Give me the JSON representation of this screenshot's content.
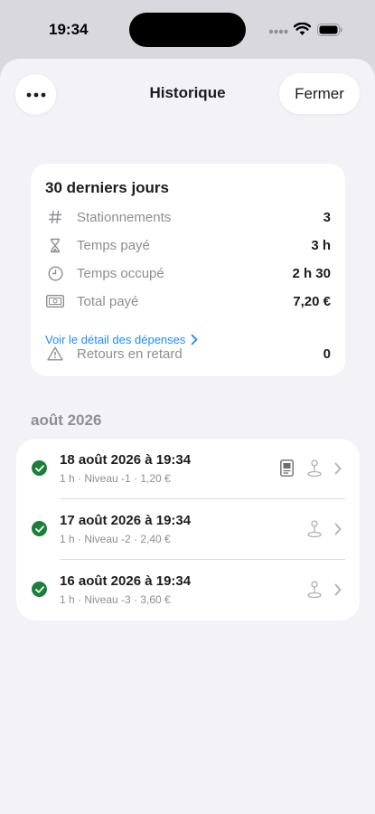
{
  "status_bar": {
    "time": "19:34"
  },
  "header": {
    "title": "Historique",
    "more_icon": "ellipsis-icon",
    "close_label": "Fermer"
  },
  "summary": {
    "title": "30 derniers jours",
    "stats": [
      {
        "icon": "hash-icon",
        "label": "Stationnements",
        "value": "3"
      },
      {
        "icon": "hourglass-icon",
        "label": "Temps payé",
        "value": "3 h"
      },
      {
        "icon": "clock-icon",
        "label": "Temps occupé",
        "value": "2 h 30"
      },
      {
        "icon": "banknote-icon",
        "label": "Total payé",
        "value": "7,20 €"
      }
    ],
    "detail_link": "Voir le détail des dépenses",
    "late": {
      "icon": "warning-icon",
      "label": "Retours en retard",
      "value": "0"
    }
  },
  "history": {
    "section": "août 2026",
    "items": [
      {
        "title": "18 août 2026 à 19:34",
        "subtitle": "1 h · Niveau -1 · 1,20 €",
        "has_receipt": true
      },
      {
        "title": "17 août 2026 à 19:34",
        "subtitle": "1 h · Niveau -2 · 2,40 €",
        "has_receipt": false
      },
      {
        "title": "16 août 2026 à 19:34",
        "subtitle": "1 h · Niveau -3 · 3,60 €",
        "has_receipt": false
      }
    ]
  },
  "colors": {
    "accent": "#1a8cff",
    "success": "#1b7f3a",
    "secondary_text": "#8e8e93",
    "background": "#f2f2f7"
  }
}
